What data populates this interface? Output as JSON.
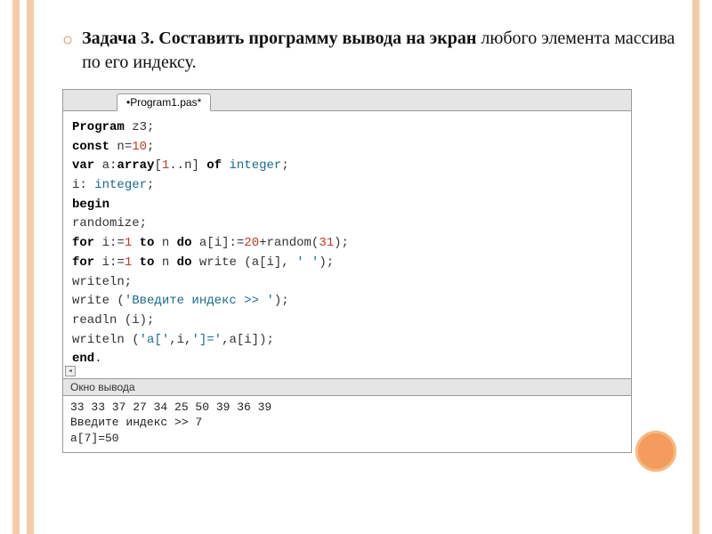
{
  "heading": {
    "bold": "Задача 3. Составить программу вывода на экран",
    "rest": "любого элемента массива по его индексу."
  },
  "ide": {
    "tab": "•Program1.pas*",
    "output_header": "Окно вывода",
    "code": {
      "l1": {
        "kw": "Program",
        "rest": " z3;"
      },
      "l2": {
        "kw": "const",
        "sp": " n=",
        "num": "10",
        "end": ";"
      },
      "l3": {
        "kw1": "var",
        "mid1": " a:",
        "kw2": "array",
        "mid2": "[",
        "num1": "1",
        "dots": "..n] ",
        "kw3": "of",
        "sp": " ",
        "type": "integer",
        "end": ";"
      },
      "l4": {
        "pre": " i: ",
        "type": "integer",
        "end": ";"
      },
      "l5": {
        "kw": "begin"
      },
      "l6": {
        "txt": " randomize;"
      },
      "l7": {
        "kw1": " for",
        "mid1": " i:=",
        "num1": "1",
        "kw2": " to",
        "mid2": " n ",
        "kw3": "do",
        "mid3": " a[i]:=",
        "num2": "20",
        "mid4": "+random(",
        "num3": "31",
        "end": ");"
      },
      "l8": {
        "kw1": " for",
        "mid1": " i:=",
        "num1": "1",
        "kw2": " to",
        "mid2": " n ",
        "kw3": "do",
        "mid3": " write (a[i], ",
        "str": "' '",
        "end": ");"
      },
      "l9": {
        "txt": " writeln;"
      },
      "l10": {
        "pre": " write (",
        "str": "'Введите индекс >> '",
        "end": ");"
      },
      "l11": {
        "txt": " readln (i);"
      },
      "l12": {
        "pre": " writeln (",
        "str1": "'a['",
        "mid": ",i,",
        "str2": "']='",
        "end": ",a[i]);"
      },
      "l13": {
        "kw": "end",
        "end": "."
      }
    },
    "output": {
      "line1": "33 33 37 27 34 25 50 39 36 39",
      "line2": "Введите индекс >> 7",
      "line3": "a[7]=50"
    }
  }
}
